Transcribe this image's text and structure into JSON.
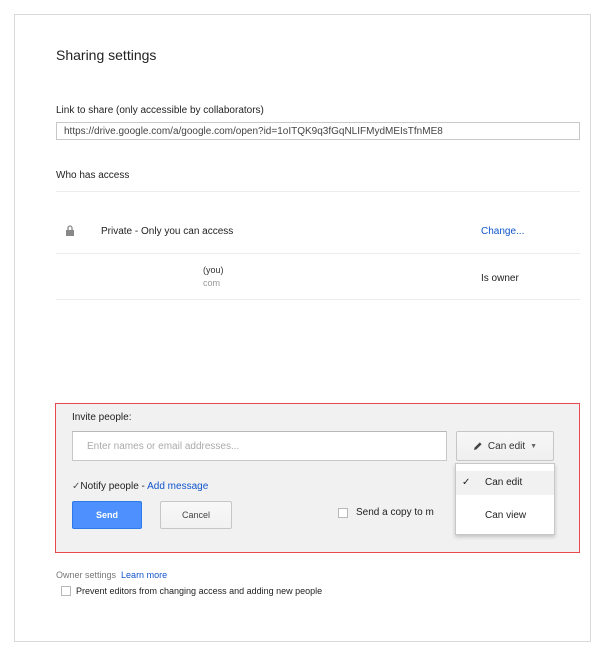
{
  "title": "Sharing settings",
  "link_section": {
    "label": "Link to share (only accessible by collaborators)",
    "url": "https://drive.google.com/a/google.com/open?id=1oITQK9q3fGqNLIFMydMEIsTfnME8"
  },
  "access": {
    "label": "Who has access",
    "rows": [
      {
        "icon": "lock-icon",
        "text": "Private - Only you can access",
        "action": "Change..."
      },
      {
        "name": "(you)",
        "email": "com",
        "role": "Is owner"
      }
    ]
  },
  "invite": {
    "label": "Invite people:",
    "placeholder": "Enter names or email addresses...",
    "permission": "Can edit",
    "notify_label": "Notify people - ",
    "add_message": "Add message",
    "send_label": "Send",
    "cancel_label": "Cancel",
    "copy_label": "Send a copy to m",
    "menu": [
      {
        "label": "Can edit",
        "selected": true
      },
      {
        "label": "Can view",
        "selected": false
      }
    ]
  },
  "owner_settings": {
    "label": "Owner settings",
    "learn_more": "Learn more",
    "prevent_label": "Prevent editors from changing access and adding new people"
  },
  "colors": {
    "accent_blue": "#4d90fe",
    "link_blue": "#1155cc",
    "highlight_red": "#e8484e"
  }
}
